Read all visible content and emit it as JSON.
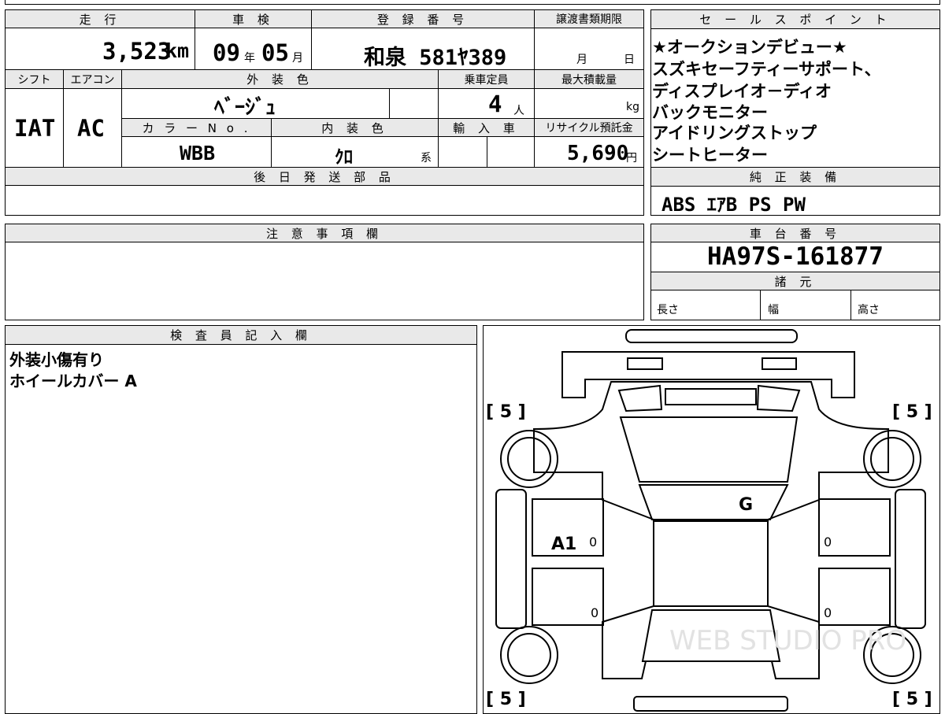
{
  "top": {
    "mileage_label": "走 行",
    "mileage_value": "3,523",
    "mileage_unit": "km",
    "inspection_label": "車 検",
    "inspection_year": "09",
    "year_unit": "年",
    "inspection_month": "05",
    "month_unit": "月",
    "registration_label": "登 録 番 号",
    "registration_value": "和泉 581ﾔ389",
    "transfer_label": "譲渡書類期限",
    "transfer_month": "月",
    "transfer_day": "日"
  },
  "row2": {
    "shift_label": "シフト",
    "shift_value": "IAT",
    "ac_label": "エアコン",
    "ac_value": "AC",
    "exterior_label": "外 装 色",
    "exterior_value": "ﾍﾞｰｼﾞｭ",
    "seating_label": "乗車定員",
    "seating_value": "4",
    "seating_unit": "人",
    "load_label": "最大積載量",
    "load_unit": "kg",
    "color_no_label": "カ ラ ー N o .",
    "color_no_value": "WBB",
    "interior_label": "内 装 色",
    "interior_value": "ｸﾛ",
    "interior_unit": "系",
    "import_label": "輸 入 車",
    "recycle_label": "リサイクル預託金",
    "recycle_value": "5,690",
    "recycle_unit": "円"
  },
  "later_parts_label": "後 日 発 送 部 品",
  "notes_label": "注 意 事 項 欄",
  "sales_points": {
    "label": "セ ー ル ス ポ イ ン ト",
    "lines": [
      "★オークションデビュー★",
      "スズキセーフティーサポート、",
      "ディスプレイオ－ディオ",
      "バックモニター",
      "アイドリングストップ",
      "シートヒーター"
    ]
  },
  "equipment": {
    "label": "純 正 装 備",
    "value": "ABS ｴｱB PS PW"
  },
  "chassis": {
    "label": "車 台 番 号",
    "value": "HA97S-161877"
  },
  "specs": {
    "label": "諸 元",
    "length_label": "長さ",
    "width_label": "幅",
    "height_label": "高さ"
  },
  "inspector": {
    "label": "検 査 員 記 入 欄",
    "lines": [
      "外装小傷有り",
      "ホイールカバー A"
    ]
  },
  "diagram": {
    "tire_fl": "[ 5 ]",
    "tire_fr": "[ 5 ]",
    "tire_rl": "[ 5 ]",
    "tire_rr": "[ 5 ]",
    "mark_g": "G",
    "mark_a1": "A1",
    "zero": "0",
    "watermark": "WEB STUDIO PRO"
  }
}
